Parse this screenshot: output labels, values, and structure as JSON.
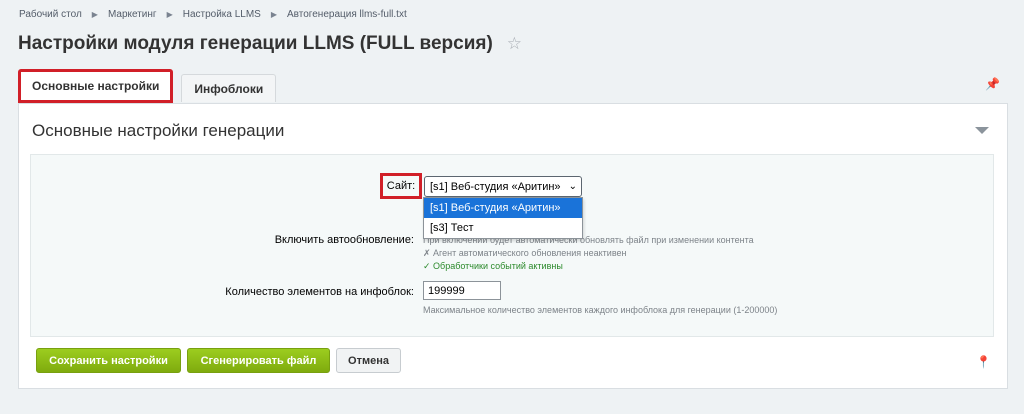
{
  "breadcrumbs": [
    "Рабочий стол",
    "Маркетинг",
    "Настройка LLMS",
    "Автогенерация llms-full.txt"
  ],
  "page_title": "Настройки модуля генерации LLMS (FULL версия)",
  "tabs": [
    {
      "label": "Основные настройки",
      "active": true
    },
    {
      "label": "Инфоблоки",
      "active": false
    }
  ],
  "section": {
    "title": "Основные настройки генерации"
  },
  "site_field": {
    "label": "Сайт:",
    "selected": "[s1] Веб-студия «Аритин»",
    "options": [
      "[s1] Веб-студия «Аритин»",
      "[s3] Тест"
    ]
  },
  "autoupdate_field": {
    "label": "Включить автообновление:",
    "hint_1": "При включении будет автоматически обновлять файл при изменении контента",
    "hint_2": "✗ Агент автоматического обновления неактивен",
    "hint_3": "✓ Обработчики событий активны"
  },
  "count_field": {
    "label": "Количество элементов на инфоблок:",
    "value": "199999",
    "hint": "Максимальное количество элементов каждого инфоблока для генерации (1-200000)"
  },
  "buttons": {
    "save": "Сохранить настройки",
    "generate": "Сгенерировать файл",
    "cancel": "Отмена"
  },
  "colors": {
    "accent_green": "#8cbd17",
    "highlight_red": "#d11f28",
    "selected_blue": "#1a73d9"
  }
}
